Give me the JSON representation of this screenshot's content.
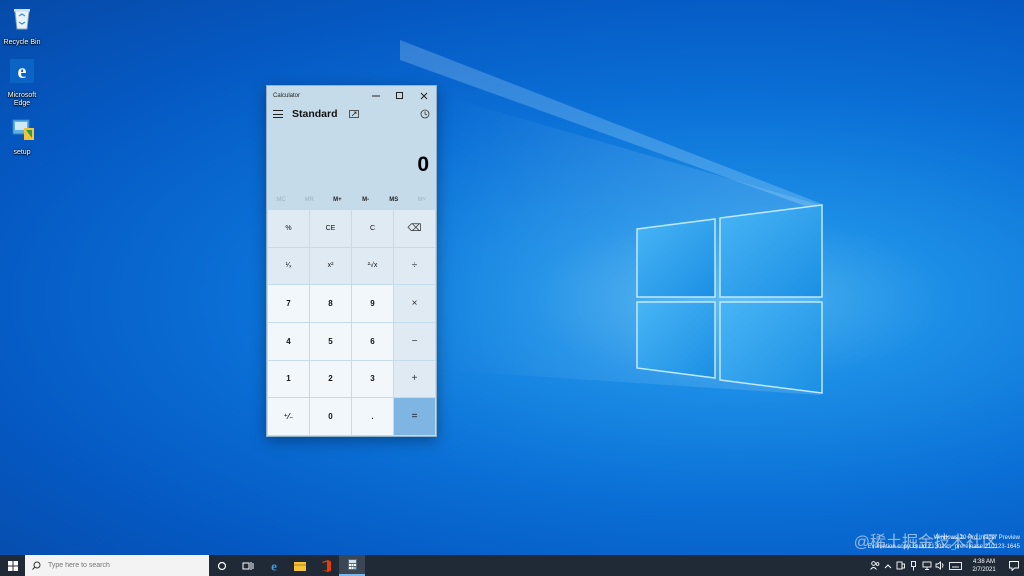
{
  "desktop": {
    "icons": [
      {
        "label": "Recycle Bin",
        "icon": "recycle-bin-icon"
      },
      {
        "label": "Microsoft Edge",
        "icon": "edge-icon"
      },
      {
        "label": "setup",
        "icon": "setup-icon"
      }
    ]
  },
  "calculator": {
    "window_title": "Calculator",
    "mode": "Standard",
    "display_value": "0",
    "memory_buttons": [
      "MC",
      "MR",
      "M+",
      "M-",
      "MS",
      "M˅"
    ],
    "keys": [
      {
        "label": "%",
        "kind": "fn"
      },
      {
        "label": "CE",
        "kind": "fn"
      },
      {
        "label": "C",
        "kind": "fn"
      },
      {
        "label": "⌫",
        "kind": "fn"
      },
      {
        "label": "¹⁄ₓ",
        "kind": "fn"
      },
      {
        "label": "x²",
        "kind": "fn"
      },
      {
        "label": "²√x",
        "kind": "fn"
      },
      {
        "label": "÷",
        "kind": "op"
      },
      {
        "label": "7",
        "kind": "num"
      },
      {
        "label": "8",
        "kind": "num"
      },
      {
        "label": "9",
        "kind": "num"
      },
      {
        "label": "×",
        "kind": "op"
      },
      {
        "label": "4",
        "kind": "num"
      },
      {
        "label": "5",
        "kind": "num"
      },
      {
        "label": "6",
        "kind": "num"
      },
      {
        "label": "−",
        "kind": "op"
      },
      {
        "label": "1",
        "kind": "num"
      },
      {
        "label": "2",
        "kind": "num"
      },
      {
        "label": "3",
        "kind": "num"
      },
      {
        "label": "+",
        "kind": "op"
      },
      {
        "label": "⁺⁄₋",
        "kind": "num"
      },
      {
        "label": "0",
        "kind": "num"
      },
      {
        "label": ".",
        "kind": "num"
      },
      {
        "label": "=",
        "kind": "equals"
      }
    ]
  },
  "watermark": {
    "line1": "Windows 10 Pro Insider Preview",
    "line2": "Evaluation copy. Build 21301.rs_prerelease.210123-1645",
    "logo_text": "@稀土掘金技术社区"
  },
  "taskbar": {
    "search_placeholder": "Type here to search",
    "apps": [
      "cortana-icon",
      "task-view-icon",
      "edge-icon",
      "file-explorer-icon",
      "office-icon",
      "calculator-icon"
    ],
    "clock_time": "4:38 AM",
    "clock_date": "2/7/2021"
  },
  "colors": {
    "taskbar": "#1f2a36",
    "calc_background": "#c5dbe9",
    "equals_accent": "#7fb5e3"
  }
}
